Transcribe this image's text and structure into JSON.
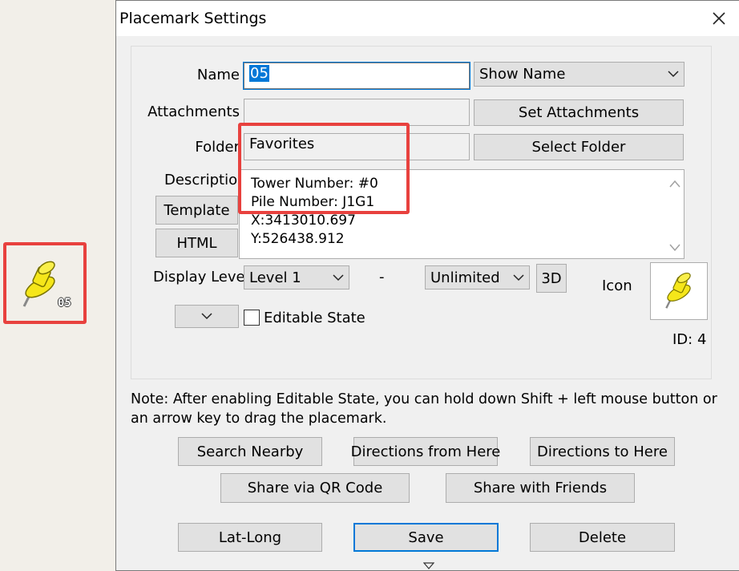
{
  "map_marker": {
    "label": "05"
  },
  "dialog": {
    "title": "Placemark Settings",
    "name": {
      "label": "Name",
      "value": "05",
      "display_option": "Show Name"
    },
    "attachments": {
      "label": "Attachments",
      "value": "",
      "button": "Set Attachments"
    },
    "folder": {
      "label": "Folder",
      "value": "Favorites",
      "button": "Select Folder"
    },
    "description": {
      "label": "Description",
      "lines": [
        "Tower Number: #0",
        "Pile Number: J1G1",
        "X:3413010.697",
        "Y:526438.912"
      ],
      "template_button": "Template",
      "html_button": "HTML"
    },
    "display_level": {
      "label": "Display Level",
      "min": "Level 1",
      "separator": "-",
      "max": "Unlimited",
      "button_3d": "3D"
    },
    "icon": {
      "label": "Icon",
      "id_label": "ID: 4"
    },
    "editable_state": {
      "label": "Editable State",
      "checked": false
    },
    "note": "Note: After enabling Editable State, you can hold down Shift + left mouse button or an arrow key to drag the placemark.",
    "buttons": {
      "search_nearby": "Search Nearby",
      "directions_from": "Directions from Here",
      "directions_to": "Directions to Here",
      "share_qr": "Share via QR Code",
      "share_friends": "Share with Friends",
      "lat_long": "Lat-Long",
      "save": "Save",
      "delete": "Delete"
    }
  },
  "colors": {
    "accent": "#0078d7",
    "highlight": "#e8413e",
    "pin": "#f5e61a"
  }
}
